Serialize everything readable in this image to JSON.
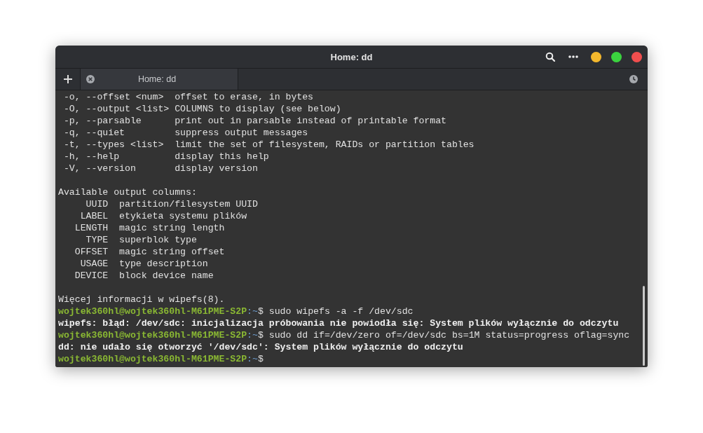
{
  "window": {
    "title": "Home: dd",
    "controls": [
      {
        "color": "#f4b82d"
      },
      {
        "color": "#3bd33f"
      },
      {
        "color": "#f04e4e"
      }
    ]
  },
  "tabs": [
    {
      "label": "Home: dd",
      "selected": true
    }
  ],
  "terminal": {
    "lines": [
      {
        "kind": "text",
        "text": " -o, --offset <num>  offset to erase, in bytes"
      },
      {
        "kind": "text",
        "text": " -O, --output <list> COLUMNS to display (see below)"
      },
      {
        "kind": "text",
        "text": " -p, --parsable      print out in parsable instead of printable format"
      },
      {
        "kind": "text",
        "text": " -q, --quiet         suppress output messages"
      },
      {
        "kind": "text",
        "text": " -t, --types <list>  limit the set of filesystem, RAIDs or partition tables"
      },
      {
        "kind": "text",
        "text": " -h, --help          display this help"
      },
      {
        "kind": "text",
        "text": " -V, --version       display version"
      },
      {
        "kind": "blank"
      },
      {
        "kind": "text",
        "text": "Available output columns:"
      },
      {
        "kind": "text",
        "text": "     UUID  partition/filesystem UUID"
      },
      {
        "kind": "text",
        "text": "    LABEL  etykieta systemu plików"
      },
      {
        "kind": "text",
        "text": "   LENGTH  magic string length"
      },
      {
        "kind": "text",
        "text": "     TYPE  superblok type"
      },
      {
        "kind": "text",
        "text": "   OFFSET  magic string offset"
      },
      {
        "kind": "text",
        "text": "    USAGE  type description"
      },
      {
        "kind": "text",
        "text": "   DEVICE  block device name"
      },
      {
        "kind": "blank"
      },
      {
        "kind": "text",
        "text": "Więcej informacji w wipefs(8)."
      },
      {
        "kind": "prompt",
        "user_host": "wojtek360hl@wojtek360hl-M61PME-S2P",
        "path": ":~",
        "symbol": "$",
        "command": " sudo wipefs -a -f /dev/sdc"
      },
      {
        "kind": "error",
        "text": "wipefs: błąd: /dev/sdc: inicjalizacja próbowania nie powiodła się: System plików wyłącznie do odczytu"
      },
      {
        "kind": "prompt",
        "user_host": "wojtek360hl@wojtek360hl-M61PME-S2P",
        "path": ":~",
        "symbol": "$",
        "command": " sudo dd if=/dev/zero of=/dev/sdc bs=1M status=progress oflag=sync"
      },
      {
        "kind": "error",
        "text": "dd: nie udało się otworzyć '/dev/sdc': System plików wyłącznie do odczytu"
      },
      {
        "kind": "prompt",
        "user_host": "wojtek360hl@wojtek360hl-M61PME-S2P",
        "path": ":~",
        "symbol": "$"
      }
    ]
  }
}
